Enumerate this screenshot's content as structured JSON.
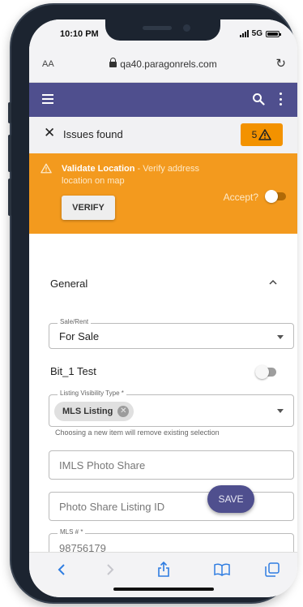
{
  "status_bar": {
    "time": "10:10 PM",
    "network": "5G"
  },
  "browser": {
    "text_size": "AA",
    "url": "qa40.paragonrels.com",
    "reload_icon": "reload-icon"
  },
  "app_bar": {
    "menu_icon": "hamburger-icon",
    "search_icon": "search-icon",
    "more_icon": "kebab-icon",
    "color": "#4f4f8e"
  },
  "issues": {
    "close_icon": "close-icon",
    "title": "Issues found",
    "count": "5",
    "badge_color": "#f39200"
  },
  "warning": {
    "title": "Validate Location",
    "separator": " - ",
    "text": "Verify address location on map",
    "verify_label": "VERIFY",
    "accept_label": "Accept?",
    "accept_on": true,
    "color": "#f39a1e"
  },
  "general": {
    "section_title": "General",
    "sale_rent": {
      "label": "Sale/Rent",
      "value": "For Sale"
    },
    "bit_test": {
      "label": "Bit_1 Test",
      "on": false
    },
    "listing_visibility": {
      "label": "Listing Visibility Type *",
      "chip": "MLS Listing",
      "helper": "Choosing a new item will remove existing selection"
    },
    "imls_photo_share": {
      "placeholder": "IMLS Photo Share"
    },
    "photo_share_listing_id": {
      "placeholder": "Photo Share Listing ID"
    },
    "mls_number": {
      "label": "MLS # *",
      "value": "98756179"
    }
  },
  "fab": {
    "label": "SAVE"
  },
  "toolbar": {
    "items": [
      "back-icon",
      "forward-icon",
      "share-icon",
      "bookmarks-icon",
      "tabs-icon"
    ]
  }
}
